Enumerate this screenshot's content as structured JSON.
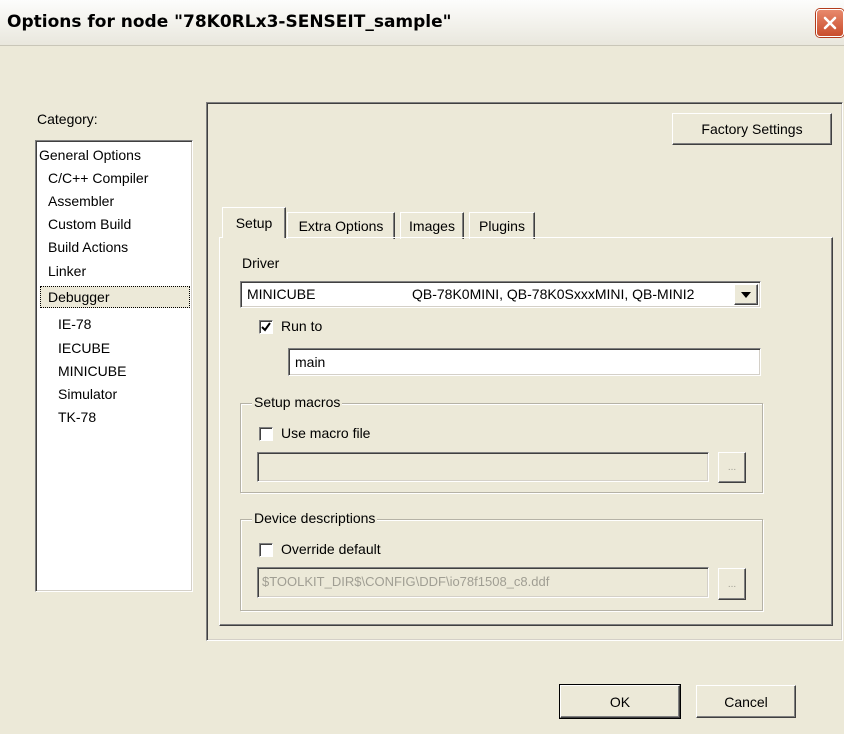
{
  "window": {
    "title": "Options for node \"78K0RLx3-SENSEIT_sample\""
  },
  "category": {
    "label": "Category:",
    "items": [
      "General Options",
      "C/C++ Compiler",
      "Assembler",
      "Custom Build",
      "Build Actions",
      "Linker",
      "Debugger",
      "IE-78",
      "IECUBE",
      "MINICUBE",
      "Simulator",
      "TK-78"
    ],
    "selected": "Debugger"
  },
  "panel": {
    "factory_settings_label": "Factory Settings"
  },
  "tabs": [
    {
      "label": "Setup",
      "active": true
    },
    {
      "label": "Extra Options",
      "active": false
    },
    {
      "label": "Images",
      "active": false
    },
    {
      "label": "Plugins",
      "active": false
    }
  ],
  "setup": {
    "driver_label": "Driver",
    "driver_name": "MINICUBE",
    "driver_desc": "QB-78K0MINI, QB-78K0SxxxMINI, QB-MINI2",
    "run_to_label": "Run to",
    "run_to_checked": true,
    "run_to_value": "main",
    "macros_group_label": "Setup macros",
    "use_macro_label": "Use macro file",
    "use_macro_checked": false,
    "macro_file_value": "",
    "browse_label": "...",
    "device_group_label": "Device descriptions",
    "override_label": "Override default",
    "override_checked": false,
    "device_file_value": "$TOOLKIT_DIR$\\CONFIG\\DDF\\io78f1508_c8.ddf"
  },
  "buttons": {
    "ok_label": "OK",
    "cancel_label": "Cancel"
  },
  "colors": {
    "dialog_bg": "#ece9d8",
    "close_button": "#c94d2c"
  }
}
